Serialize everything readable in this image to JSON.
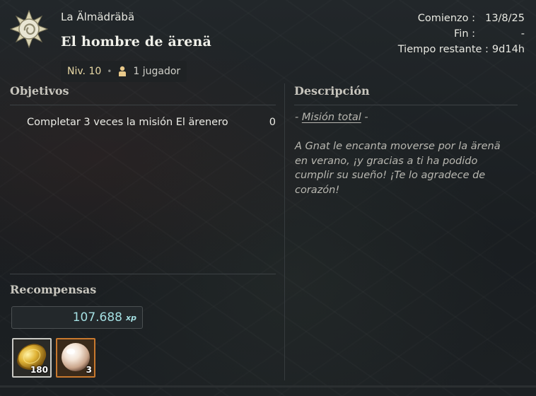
{
  "header": {
    "area_name": "La Älmädräbä",
    "quest_title": "El hombre de ärenä",
    "level": "Niv. 10",
    "separator": "•",
    "players": "1 jugador"
  },
  "dates": {
    "start_label": "Comienzo :",
    "start_value": "13/8/25",
    "end_label": "Fin :",
    "end_value": "-",
    "remaining_label": "Tiempo restante :",
    "remaining_value": "9d14h"
  },
  "objectives": {
    "title": "Objetivos",
    "items": [
      {
        "text": "Completar 3 veces la misión El ärenero",
        "count": "0"
      }
    ]
  },
  "description": {
    "title": "Descripción",
    "subtitle_prefix": "- ",
    "subtitle_link": "Misión total",
    "subtitle_suffix": " -",
    "body": "A Gnat le encanta moverse por la ärenä en verano, ¡y gracias a ti ha podido cumplir su sueño! ¡Te lo agradece de corazón!"
  },
  "rewards": {
    "title": "Recompensas",
    "xp_value": "107.688",
    "xp_label": "xp",
    "items": [
      {
        "icon": "gold-coin-icon",
        "quantity": "180",
        "rarity_color": "#c9c9c4"
      },
      {
        "icon": "pearl-icon",
        "quantity": "3",
        "rarity_color": "#c9792e"
      }
    ]
  },
  "colors": {
    "xp": "#a4dfe2",
    "level": "#e9d9a6",
    "section_title": "#c7c5bd"
  }
}
